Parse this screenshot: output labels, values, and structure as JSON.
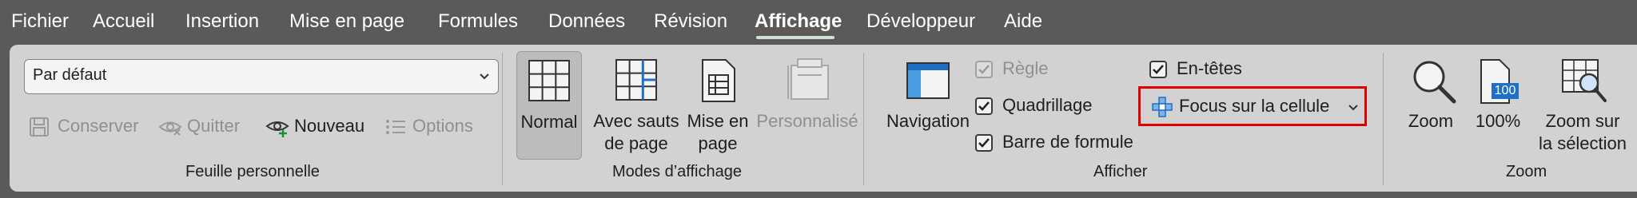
{
  "menu": {
    "tabs": [
      {
        "label": "Fichier"
      },
      {
        "label": "Accueil"
      },
      {
        "label": "Insertion"
      },
      {
        "label": "Mise en page"
      },
      {
        "label": "Formules"
      },
      {
        "label": "Données"
      },
      {
        "label": "Révision"
      },
      {
        "label": "Affichage"
      },
      {
        "label": "Développeur"
      },
      {
        "label": "Aide"
      }
    ],
    "active_tab": "Affichage"
  },
  "sheet_view": {
    "dropdown_value": "Par défaut",
    "keep_label": "Conserver",
    "exit_label": "Quitter",
    "new_label": "Nouveau",
    "options_label": "Options",
    "group_label": "Feuille personnelle"
  },
  "workbook_views": {
    "normal_label": "Normal",
    "page_break_line1": "Avec sauts",
    "page_break_line2": "de page",
    "page_layout_line1": "Mise en",
    "page_layout_line2": "page",
    "custom_label": "Personnalisé",
    "group_label": "Modes d’affichage"
  },
  "show": {
    "navigation_label": "Navigation",
    "ruler_label": "Règle",
    "gridlines_label": "Quadrillage",
    "formula_bar_label": "Barre de formule",
    "headings_label": "En-têtes",
    "focus_cell_label": "Focus sur la cellule",
    "group_label": "Afficher"
  },
  "zoom": {
    "zoom_label": "Zoom",
    "hundred_label": "100%",
    "hundred_icon_text": "100",
    "selection_line1": "Zoom sur",
    "selection_line2": "la sélection",
    "group_label": "Zoom"
  },
  "colors": {
    "menu_bg": "#5c5a59",
    "ribbon_bg": "#d2d2d2",
    "accent_blue": "#1f6fc5",
    "highlight_red": "#e00000",
    "tab_underline": "#cfe4d6"
  }
}
